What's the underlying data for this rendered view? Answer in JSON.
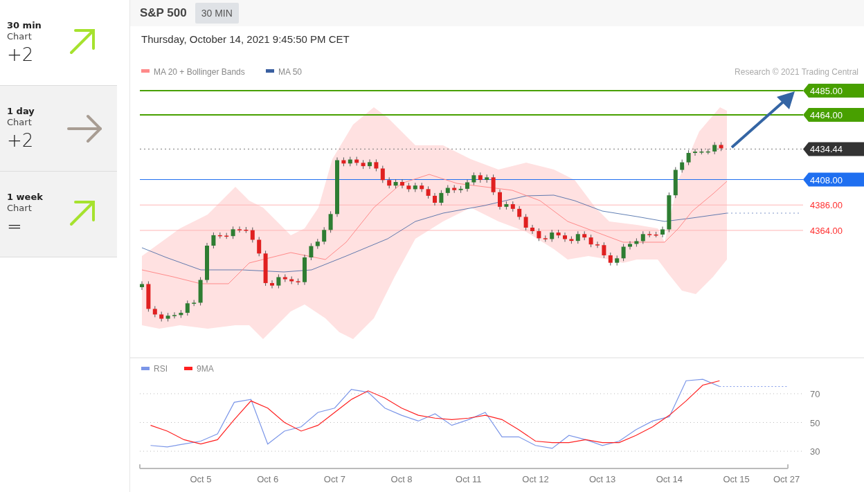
{
  "sidebar": {
    "items": [
      {
        "period": "30 min",
        "label": "Chart",
        "score": "+2",
        "rising": true,
        "color": "#a6e22e",
        "selected": true
      },
      {
        "period": "1 day",
        "label": "Chart",
        "score": "+2",
        "rising": false,
        "color": "#a89d93",
        "selected": false
      },
      {
        "period": "1 week",
        "label": "Chart",
        "score": "=",
        "rising": true,
        "color": "#a6e22e",
        "selected": false
      }
    ]
  },
  "header": {
    "title": "S&P 500",
    "interval": "30 MIN",
    "timestamp": "Thursday, October 14, 2021 9:45:50 PM CET"
  },
  "price_chart": {
    "legend": [
      {
        "label": "MA 20 + Bollinger Bands",
        "color": "#ff8a8a"
      },
      {
        "label": "MA 50",
        "color": "#3a5fa0"
      }
    ],
    "credit": "Research © 2021 Trading Central",
    "levels": [
      {
        "label": "4485.00",
        "kind": "target",
        "color": "#48a000"
      },
      {
        "label": "4464.00",
        "kind": "target",
        "color": "#48a000"
      },
      {
        "label": "4434.44",
        "kind": "last",
        "color": "#333333"
      },
      {
        "label": "4408.00",
        "kind": "pivot",
        "color": "#1f6ff0"
      },
      {
        "label": "4386.00",
        "kind": "support",
        "color": "#ff3030"
      },
      {
        "label": "4364.00",
        "kind": "support",
        "color": "#ff3030"
      }
    ]
  },
  "rsi_chart": {
    "chart_data": {
      "type": "line",
      "categories": [
        null,
        null,
        null,
        "Oct 5",
        null,
        null,
        null,
        "Oct 6",
        null,
        null,
        null,
        "Oct 7",
        null,
        null,
        null,
        "Oct 8",
        null,
        null,
        null,
        "Oct 11",
        null,
        null,
        null,
        "Oct 12",
        null,
        null,
        null,
        "Oct 13",
        null,
        null,
        null,
        "Oct 14",
        null,
        null,
        null,
        "Oct 15",
        null,
        null,
        "Oct 27"
      ],
      "series": [
        {
          "name": "RSI",
          "color": "#7b96e8",
          "values": [
            34,
            33,
            35,
            37,
            42,
            64,
            66,
            35,
            44,
            47,
            57,
            60,
            73,
            71,
            60,
            55,
            51,
            56,
            48,
            52,
            57,
            40,
            40,
            34,
            32,
            41,
            38,
            34,
            37,
            45,
            51,
            54,
            79,
            80,
            75,
            null,
            null,
            null,
            null
          ]
        },
        {
          "name": "9MA",
          "color": "#ff2020",
          "values": [
            48,
            44,
            38,
            35,
            38,
            52,
            65,
            60,
            50,
            44,
            48,
            57,
            66,
            72,
            67,
            60,
            55,
            53,
            52,
            53,
            55,
            52,
            45,
            37,
            36,
            36,
            38,
            36,
            36,
            41,
            47,
            55,
            65,
            76,
            79,
            null,
            null,
            null,
            null
          ]
        }
      ],
      "legend": "upper left",
      "grid": true,
      "ref_lines": [
        {
          "axis": "y",
          "value": 75,
          "color": "#7b96e8"
        }
      ],
      "ylim": [
        18,
        95
      ],
      "yticks": [
        30,
        50,
        70
      ]
    }
  }
}
